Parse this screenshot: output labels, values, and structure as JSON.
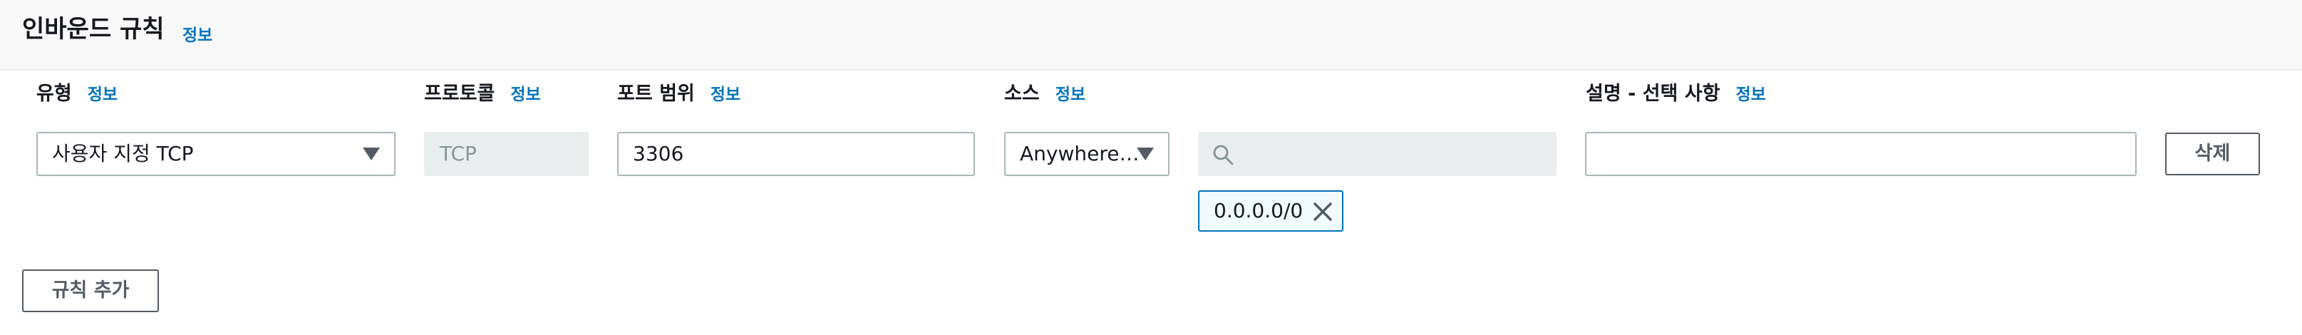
{
  "section": {
    "title": "인바운드 규칙",
    "info": "정보"
  },
  "columns": {
    "type": {
      "label": "유형",
      "info": "정보"
    },
    "protocol": {
      "label": "프로토콜",
      "info": "정보"
    },
    "port_range": {
      "label": "포트 범위",
      "info": "정보"
    },
    "source": {
      "label": "소스",
      "info": "정보"
    },
    "description": {
      "label": "설명 - 선택 사항",
      "info": "정보"
    }
  },
  "rule": {
    "type_value": "사용자 지정 TCP",
    "protocol_value": "TCP",
    "port_range_value": "3306",
    "source_value": "Anywhere…",
    "cidr_search_value": "",
    "cidr_token": "0.0.0.0/0",
    "description_value": "",
    "delete_label": "삭제"
  },
  "actions": {
    "add_rule_label": "규칙 추가"
  },
  "icons": {
    "dropdown": "caret-down-icon",
    "search": "search-icon",
    "remove": "close-icon"
  },
  "colors": {
    "info_link": "#0073bb",
    "token_border": "#0073bb",
    "header_bg": "#f8f8f8"
  }
}
